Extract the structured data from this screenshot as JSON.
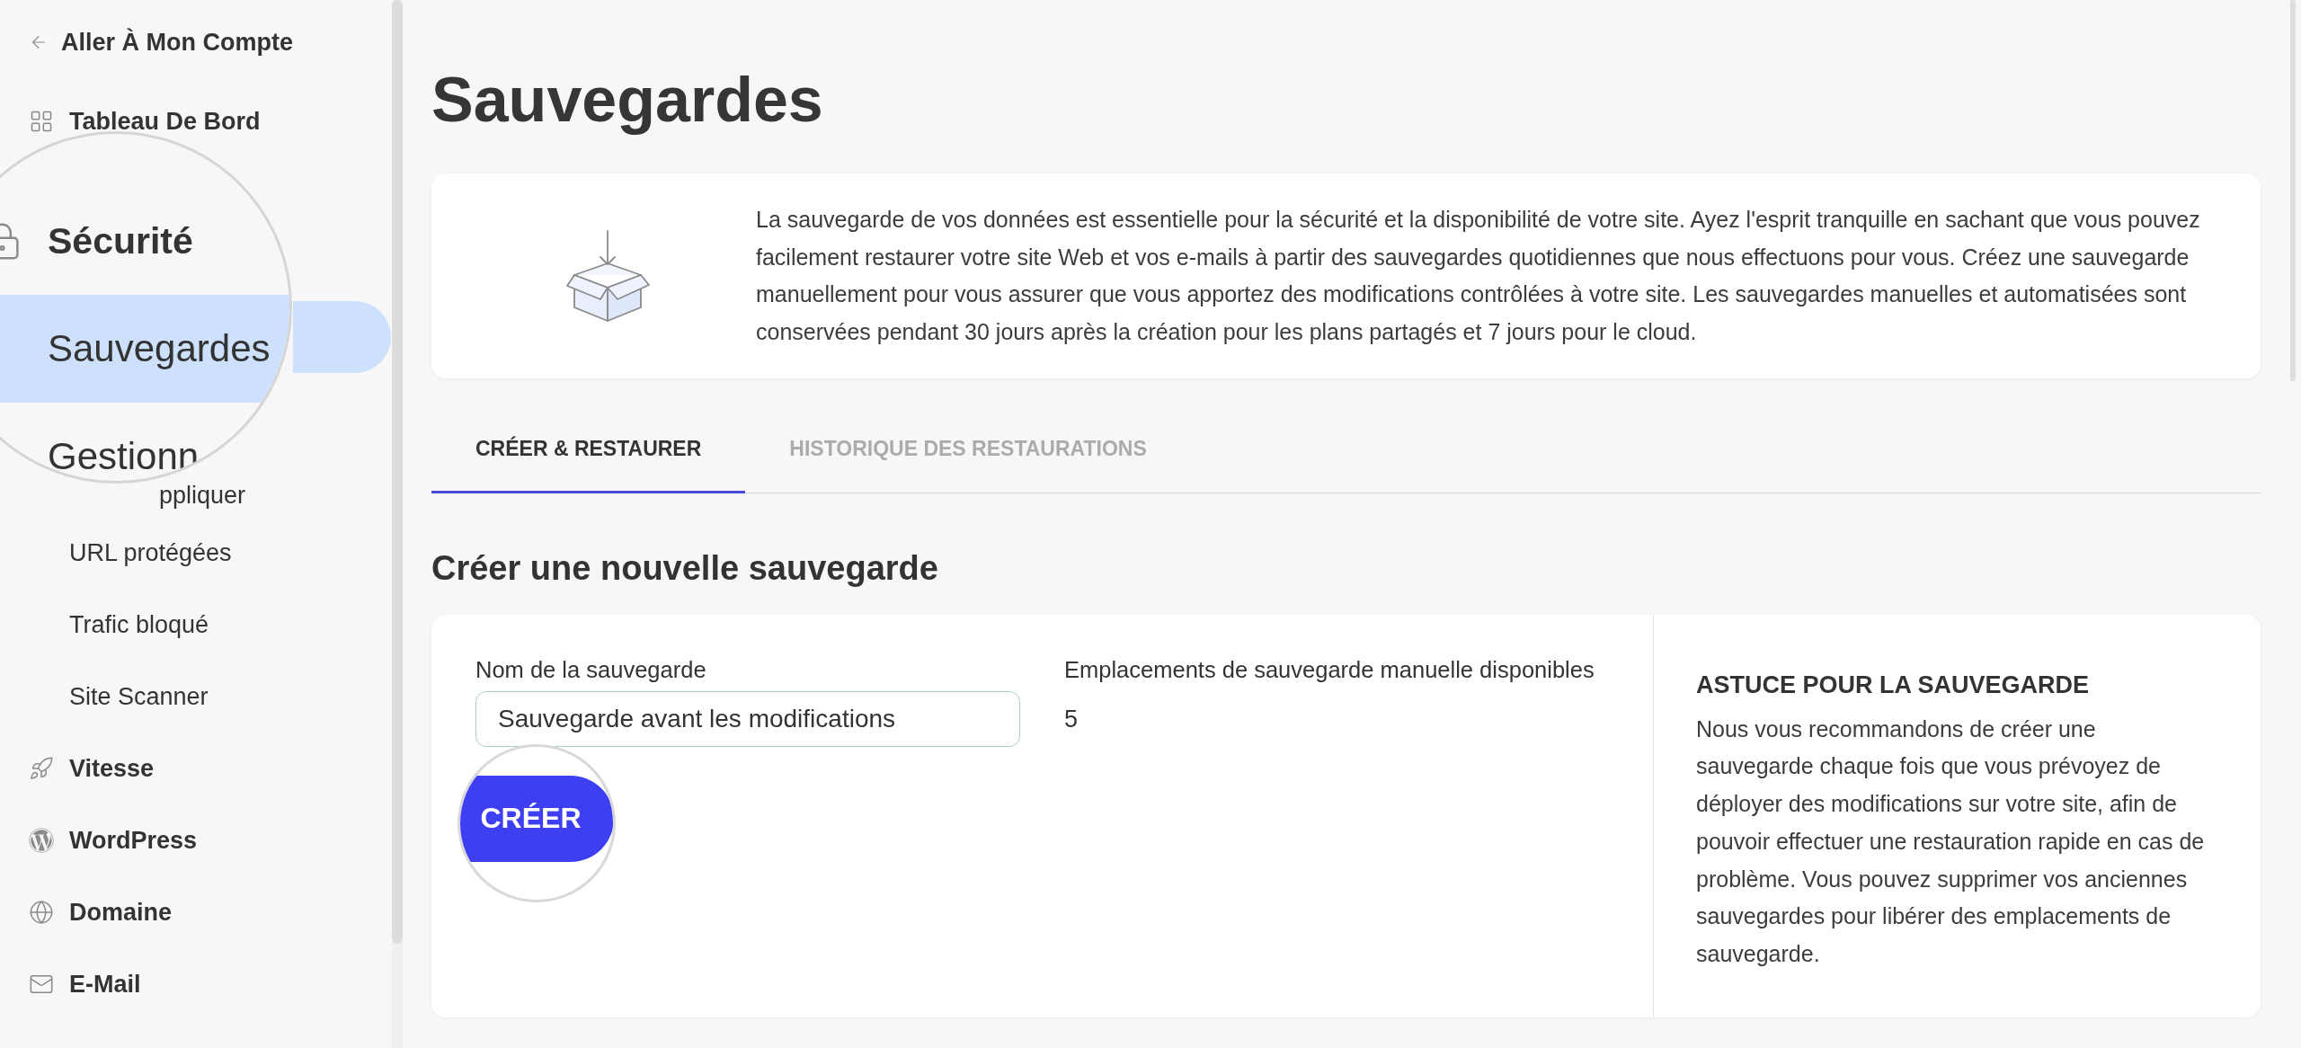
{
  "sidebar": {
    "back_link": {
      "label": "Aller À Mon Compte"
    },
    "items": [
      {
        "kind": "section",
        "label": "Tableau De Bord",
        "selected": false
      },
      {
        "kind": "covered",
        "selected": true
      },
      {
        "kind": "partial",
        "label": "ppliquer",
        "selected": false
      },
      {
        "kind": "subitem",
        "label": "URL protégées",
        "selected": false
      },
      {
        "kind": "subitem",
        "label": "Trafic bloqué",
        "selected": false
      },
      {
        "kind": "subitem",
        "label": "Site Scanner",
        "selected": false
      },
      {
        "kind": "section",
        "label": "Vitesse",
        "selected": false
      },
      {
        "kind": "section",
        "label": "WordPress",
        "selected": false
      },
      {
        "kind": "section",
        "label": "Domaine",
        "selected": false
      },
      {
        "kind": "section",
        "label": "E-Mail",
        "selected": false
      }
    ]
  },
  "sidebar_lens": {
    "items": [
      {
        "kind": "section",
        "label": "Sécurité",
        "selected": false
      },
      {
        "kind": "subitem",
        "label": "Sauvegardes",
        "selected": true
      },
      {
        "kind": "subitem",
        "label": "Gestionn",
        "selected": false
      }
    ]
  },
  "page": {
    "title": "Sauvegardes",
    "intro": "La sauvegarde de vos données est essentielle pour la sécurité et la disponibilité de votre site. Ayez l'esprit tranquille en sachant que vous pouvez\nfacilement restaurer votre site Web et vos e-mails à partir des sauvegardes quotidiennes que nous effectuons pour vous. Créez une sauvegarde\nmanuellement pour vous assurer que vous apportez des modifications contrôlées à votre site. Les sauvegardes manuelles et automatisées sont\nconservées pendant 30 jours après la création pour les plans partagés et 7 jours pour le cloud."
  },
  "tabs": [
    {
      "label": "CRÉER & RESTAURER",
      "selected": true
    },
    {
      "label": "HISTORIQUE DES RESTAURATIONS",
      "selected": false
    }
  ],
  "create_section": {
    "heading": "Créer une nouvelle sauvegarde",
    "name_label": "Nom de la sauvegarde",
    "name_value": "Sauvegarde avant les modifications",
    "slots_label": "Emplacements de sauvegarde manuelle disponibles",
    "slots_value": "5",
    "create_button": {
      "label": "CRÉER"
    }
  },
  "tip": {
    "title": "ASTUCE POUR LA SAUVEGARDE",
    "text": "Nous vous recommandons de créer une\nsauvegarde chaque fois que vous prévoyez de\ndéployer des modifications sur votre site, afin de\npouvoir effectuer une restauration rapide en cas de\nproblème. Vous pouvez supprimer vos anciennes\nsauvegardes pour libérer des emplacements de\nsauvegarde."
  }
}
